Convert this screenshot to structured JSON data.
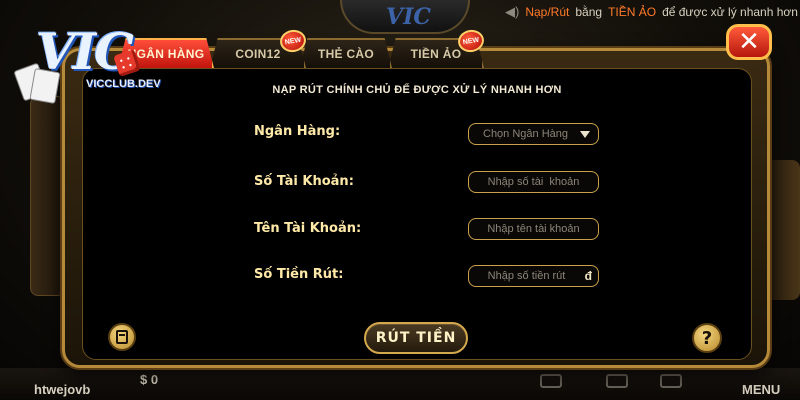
{
  "background": {
    "marquee": {
      "speaker_icon": "speaker-icon",
      "text_prefix": "Nạp/Rút",
      "text_mid1": "bằng",
      "text_highlight": "TIỀN ẢO",
      "text_suffix": "để được xử lý nhanh hơn"
    },
    "bottom": {
      "username": "htwejovb",
      "coin": "$ 0",
      "menu": "MENU"
    }
  },
  "logo": {
    "text": "VIC",
    "site": "VICCLUB.DEV"
  },
  "tabs": [
    {
      "label": "NGÂN HÀNG",
      "active": true
    },
    {
      "label": "COIN12",
      "badge": "NEW"
    },
    {
      "label": "THẺ CÀO"
    },
    {
      "label": "TIỀN ẢO",
      "badge": "NEW"
    }
  ],
  "modal": {
    "heading": "NẠP RÚT CHÍNH CHỦ ĐỂ ĐƯỢC XỬ LÝ NHANH HƠN",
    "fields": {
      "bank": {
        "label": "Ngân Hàng:",
        "value": "Chọn Ngân Hàng"
      },
      "account_number": {
        "label": "Số Tài Khoản:",
        "placeholder": "Nhập số tài  khoản"
      },
      "account_name": {
        "label": "Tên Tài Khoản:",
        "placeholder": "Nhập tên tài khoản"
      },
      "amount": {
        "label": "Số Tiền Rút:",
        "placeholder": "Nhập số tiền rút",
        "currency": "đ"
      }
    },
    "submit_label": "RÚT TIỀN",
    "help_label": "?",
    "close_label": "✕"
  },
  "colors": {
    "accent_gold": "#d4a84c",
    "active_tab": "#e0261a",
    "label_text": "#ffe9a8"
  }
}
